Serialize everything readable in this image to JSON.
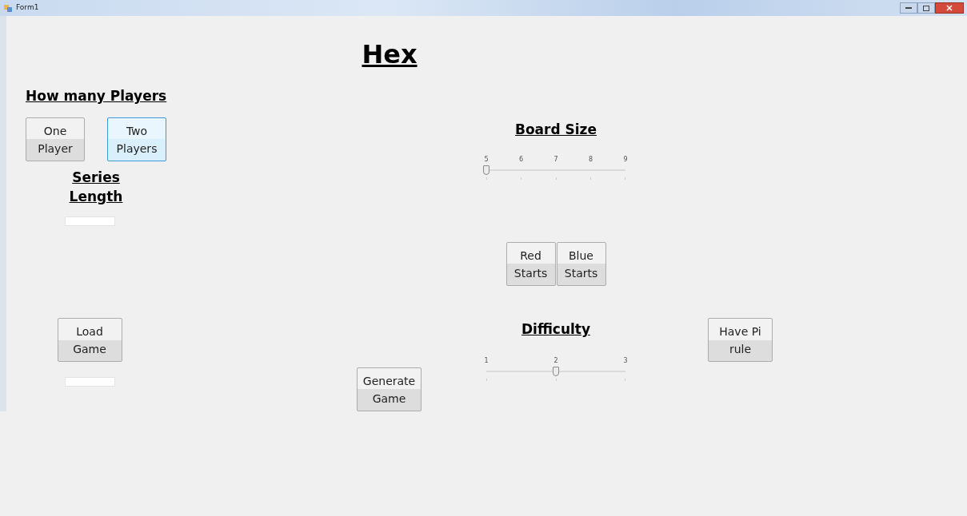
{
  "window": {
    "title": "Form1"
  },
  "title": "Hex",
  "players": {
    "heading": "How many Players",
    "buttons": [
      {
        "label": "One Player",
        "selected": false
      },
      {
        "label": "Two Players",
        "selected": true
      }
    ]
  },
  "series_length": {
    "heading": "Series Length"
  },
  "load_button": "Load Game",
  "generate_button": "Generate Game",
  "board_size": {
    "heading": "Board Size",
    "ticks": [
      "5",
      "6",
      "7",
      "8",
      "9"
    ],
    "level": 0
  },
  "start_buttons": [
    {
      "label": "Red Starts"
    },
    {
      "label": "Blue Starts"
    }
  ],
  "difficulty": {
    "heading": "Difficulty",
    "ticks": [
      "1",
      "2",
      "3"
    ],
    "level": 0.5
  },
  "pi_rule_button": "Have Pi rule"
}
